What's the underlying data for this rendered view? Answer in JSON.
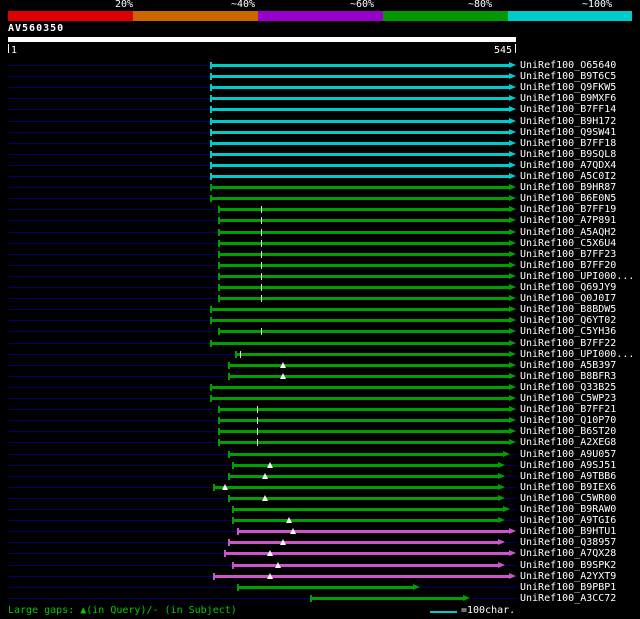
{
  "colors": {
    "cyan": "#00cccc",
    "green": "#00a000",
    "magenta": "#cc55cc",
    "baseline": "#000066",
    "legend_green": "#00cc00",
    "query_bar": "#ffffff"
  },
  "footer": {
    "gaps_text": "Large gaps: ▲(in Query)/- (in Subject)",
    "scale_text": "=100char."
  },
  "chart_data": {
    "type": "bar",
    "title": "AV560350",
    "x_range": [
      1,
      545
    ],
    "x_start_label": "1",
    "x_end_label": "545",
    "legend_position": "top",
    "identity_legend": [
      {
        "label": "20%",
        "color": "#dd0000"
      },
      {
        "label": "~40%",
        "color": "#cc6600"
      },
      {
        "label": "~60%",
        "color": "#9900cc"
      },
      {
        "label": "~80%",
        "color": "#009900"
      },
      {
        "label": "~100%",
        "color": "#00cccc"
      }
    ],
    "rows": [
      {
        "label": "UniRef100_O65640",
        "color": "cyan",
        "start": 217,
        "end": 545,
        "marks": []
      },
      {
        "label": "UniRef100_B9T6C5",
        "color": "cyan",
        "start": 217,
        "end": 545,
        "marks": []
      },
      {
        "label": "UniRef100_Q9FKW5",
        "color": "cyan",
        "start": 217,
        "end": 545,
        "marks": []
      },
      {
        "label": "UniRef100_B9MXF6",
        "color": "cyan",
        "start": 217,
        "end": 545,
        "marks": []
      },
      {
        "label": "UniRef100_B7FF14",
        "color": "cyan",
        "start": 217,
        "end": 545,
        "marks": []
      },
      {
        "label": "UniRef100_B9H172",
        "color": "cyan",
        "start": 217,
        "end": 545,
        "marks": []
      },
      {
        "label": "UniRef100_Q9SW41",
        "color": "cyan",
        "start": 217,
        "end": 545,
        "marks": []
      },
      {
        "label": "UniRef100_B7FF18",
        "color": "cyan",
        "start": 217,
        "end": 545,
        "marks": []
      },
      {
        "label": "UniRef100_B9SQL8",
        "color": "cyan",
        "start": 217,
        "end": 545,
        "marks": []
      },
      {
        "label": "UniRef100_A7QDX4",
        "color": "cyan",
        "start": 217,
        "end": 545,
        "marks": []
      },
      {
        "label": "UniRef100_A5C0I2",
        "color": "cyan",
        "start": 217,
        "end": 545,
        "marks": []
      },
      {
        "label": "UniRef100_B9HR87",
        "color": "green",
        "start": 217,
        "end": 545,
        "marks": []
      },
      {
        "label": "UniRef100_B6E0N5",
        "color": "green",
        "start": 217,
        "end": 545,
        "marks": []
      },
      {
        "label": "UniRef100_B7FF19",
        "color": "green",
        "start": 225,
        "end": 545,
        "marks": [
          {
            "type": "tick",
            "pos": 273
          }
        ]
      },
      {
        "label": "UniRef100_A7P891",
        "color": "green",
        "start": 225,
        "end": 545,
        "marks": [
          {
            "type": "tick",
            "pos": 273
          }
        ]
      },
      {
        "label": "UniRef100_A5AQH2",
        "color": "green",
        "start": 225,
        "end": 545,
        "marks": [
          {
            "type": "tick",
            "pos": 273
          }
        ]
      },
      {
        "label": "UniRef100_C5X6U4",
        "color": "green",
        "start": 225,
        "end": 545,
        "marks": [
          {
            "type": "tick",
            "pos": 273
          }
        ]
      },
      {
        "label": "UniRef100_B7FF23",
        "color": "green",
        "start": 225,
        "end": 545,
        "marks": [
          {
            "type": "tick",
            "pos": 273
          }
        ]
      },
      {
        "label": "UniRef100_B7FF20",
        "color": "green",
        "start": 225,
        "end": 545,
        "marks": [
          {
            "type": "tick",
            "pos": 273
          }
        ]
      },
      {
        "label": "UniRef100_UPI000...",
        "color": "green",
        "start": 225,
        "end": 545,
        "marks": [
          {
            "type": "tick",
            "pos": 273
          }
        ]
      },
      {
        "label": "UniRef100_Q69JY9",
        "color": "green",
        "start": 225,
        "end": 545,
        "marks": [
          {
            "type": "tick",
            "pos": 273
          }
        ]
      },
      {
        "label": "UniRef100_Q0J0I7",
        "color": "green",
        "start": 225,
        "end": 545,
        "marks": [
          {
            "type": "tick",
            "pos": 273
          }
        ]
      },
      {
        "label": "UniRef100_B8BDW5",
        "color": "green",
        "start": 217,
        "end": 545,
        "marks": []
      },
      {
        "label": "UniRef100_Q6YT02",
        "color": "green",
        "start": 217,
        "end": 545,
        "marks": []
      },
      {
        "label": "UniRef100_C5YH36",
        "color": "green",
        "start": 225,
        "end": 545,
        "marks": [
          {
            "type": "tick",
            "pos": 273
          }
        ]
      },
      {
        "label": "UniRef100_B7FF22",
        "color": "green",
        "start": 217,
        "end": 545,
        "marks": []
      },
      {
        "label": "UniRef100_UPI000...",
        "color": "green",
        "start": 244,
        "end": 545,
        "marks": [
          {
            "type": "tick",
            "pos": 250
          }
        ]
      },
      {
        "label": "UniRef100_A5B397",
        "color": "green",
        "start": 236,
        "end": 545,
        "marks": [
          {
            "type": "tri",
            "pos": 295
          }
        ]
      },
      {
        "label": "UniRef100_B8BFR3",
        "color": "green",
        "start": 236,
        "end": 545,
        "marks": [
          {
            "type": "tri",
            "pos": 295
          }
        ]
      },
      {
        "label": "UniRef100_Q33B25",
        "color": "green",
        "start": 217,
        "end": 545,
        "marks": []
      },
      {
        "label": "UniRef100_C5WP23",
        "color": "green",
        "start": 217,
        "end": 545,
        "marks": []
      },
      {
        "label": "UniRef100_B7FF21",
        "color": "green",
        "start": 225,
        "end": 545,
        "marks": [
          {
            "type": "tick",
            "pos": 268
          }
        ]
      },
      {
        "label": "UniRef100_Q10P70",
        "color": "green",
        "start": 225,
        "end": 545,
        "marks": [
          {
            "type": "tick",
            "pos": 268
          }
        ]
      },
      {
        "label": "UniRef100_B6ST20",
        "color": "green",
        "start": 225,
        "end": 545,
        "marks": [
          {
            "type": "tick",
            "pos": 268
          }
        ]
      },
      {
        "label": "UniRef100_A2XEG8",
        "color": "green",
        "start": 225,
        "end": 545,
        "marks": [
          {
            "type": "tick",
            "pos": 268
          }
        ]
      },
      {
        "label": "UniRef100_A9U057",
        "color": "green",
        "start": 236,
        "end": 539,
        "marks": []
      },
      {
        "label": "UniRef100_A9SJ51",
        "color": "green",
        "start": 240,
        "end": 533,
        "marks": [
          {
            "type": "tri",
            "pos": 281
          }
        ]
      },
      {
        "label": "UniRef100_A9TBB6",
        "color": "green",
        "start": 236,
        "end": 533,
        "marks": [
          {
            "type": "tri",
            "pos": 276
          }
        ]
      },
      {
        "label": "UniRef100_B9IEX6",
        "color": "green",
        "start": 220,
        "end": 533,
        "marks": [
          {
            "type": "tri",
            "pos": 233
          }
        ]
      },
      {
        "label": "UniRef100_C5WR00",
        "color": "green",
        "start": 236,
        "end": 533,
        "marks": [
          {
            "type": "tri",
            "pos": 276
          }
        ]
      },
      {
        "label": "UniRef100_B9RAW0",
        "color": "green",
        "start": 240,
        "end": 539,
        "marks": []
      },
      {
        "label": "UniRef100_A9TGI6",
        "color": "green",
        "start": 240,
        "end": 533,
        "marks": [
          {
            "type": "tri",
            "pos": 302
          }
        ]
      },
      {
        "label": "UniRef100_B9HTU1",
        "color": "magenta",
        "start": 246,
        "end": 545,
        "marks": [
          {
            "type": "tri",
            "pos": 306
          }
        ]
      },
      {
        "label": "UniRef100_Q38957",
        "color": "magenta",
        "start": 236,
        "end": 533,
        "marks": [
          {
            "type": "tri",
            "pos": 295
          }
        ]
      },
      {
        "label": "UniRef100_A7QX28",
        "color": "magenta",
        "start": 232,
        "end": 545,
        "marks": [
          {
            "type": "tri",
            "pos": 281
          }
        ]
      },
      {
        "label": "UniRef100_B9SPK2",
        "color": "magenta",
        "start": 240,
        "end": 533,
        "marks": [
          {
            "type": "tri",
            "pos": 290
          }
        ]
      },
      {
        "label": "UniRef100_A2YXT9",
        "color": "magenta",
        "start": 220,
        "end": 545,
        "marks": [
          {
            "type": "tri",
            "pos": 281
          }
        ]
      },
      {
        "label": "UniRef100_B9PBP1",
        "color": "green",
        "start": 246,
        "end": 442,
        "marks": []
      },
      {
        "label": "UniRef100_A3CC72",
        "color": "green",
        "start": 324,
        "end": 496,
        "marks": []
      }
    ]
  }
}
